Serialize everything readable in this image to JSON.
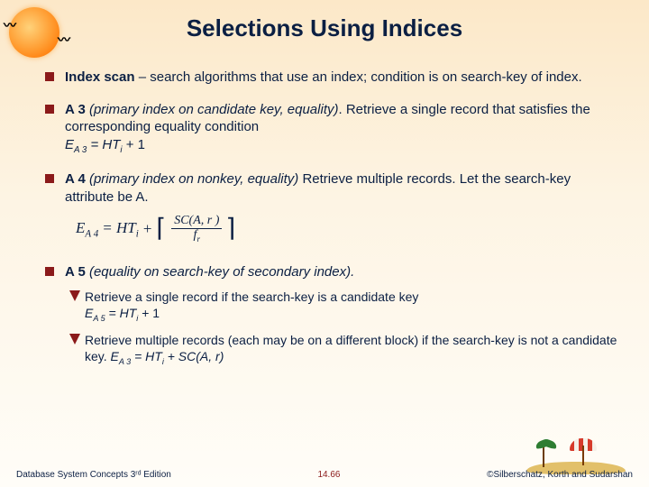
{
  "title": "Selections Using Indices",
  "bullets": {
    "b1": {
      "lead": "Index scan",
      "rest": " – search algorithms that use an index; condition is on search-key of index."
    },
    "b2": {
      "lead": "A 3 ",
      "desc": "(primary index on candidate key, equality)",
      "rest": ".  Retrieve a single record that satisfies the corresponding equality condition",
      "eq_label": "E",
      "eq_sub": "A 3",
      "eq_rhs": " = HT",
      "eq_rhs_sub": "i",
      "eq_tail": " + 1"
    },
    "b3": {
      "lead": "A 4 ",
      "desc": "(primary index on nonkey, equality)",
      "rest": " Retrieve multiple records.  Let the search-key attribute be A."
    },
    "formula": {
      "lhs": "E",
      "lhs_sub": "A 4",
      "eq": " = HT",
      "eq_sub": "i",
      "plus": " + ",
      "num": "SC(A, r )",
      "den": "f",
      "den_sub": "r"
    },
    "b4": {
      "lead": "A 5 ",
      "desc": "(equality on search-key of secondary index)."
    },
    "d1": {
      "text": "Retrieve a single record if the search-key is a candidate key",
      "eq_l": "E",
      "eq_sub": "A 5",
      "eq_r": " = HT",
      "eq_r_sub": "i",
      "eq_tail": " + 1"
    },
    "d2": {
      "text": "Retrieve multiple records (each may be on a different block) if the search-key is not a candidate key. ",
      "eq_l": "E",
      "eq_sub": "A 3",
      "eq_r": " = HT",
      "eq_r_sub": "i",
      "eq_tail": " + SC(A, r)"
    }
  },
  "footer": {
    "left": "Database System Concepts 3ʳᵈ Edition",
    "center": "14.66",
    "right": "©Silberschatz, Korth and Sudarshan"
  },
  "icons": {
    "sun": "sun-icon",
    "bird": "bird-icon",
    "island": "island-decor"
  }
}
